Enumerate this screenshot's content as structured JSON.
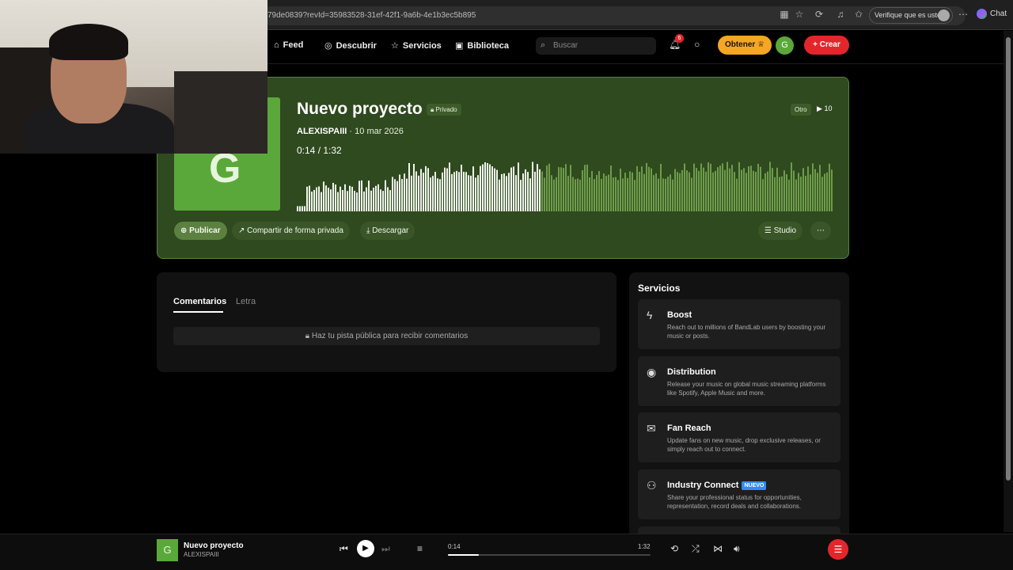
{
  "browser": {
    "url": "79de0839?revId=35983528-31ef-42f1-9a6b-4e1b3ec5b895",
    "verify_label": "Verifique que es usted",
    "chat_label": "Chat"
  },
  "nav": {
    "items": [
      {
        "label": "Feed",
        "icon": "home-icon"
      },
      {
        "label": "Descubrir",
        "icon": "compass-icon"
      },
      {
        "label": "Servicios",
        "icon": "star-icon"
      },
      {
        "label": "Biblioteca",
        "icon": "library-icon"
      }
    ],
    "search_placeholder": "Buscar",
    "notification_count": "6",
    "obtener_label": "Obtener",
    "avatar_letter": "G",
    "crear_label": "Crear"
  },
  "project": {
    "title": "Nuevo proyecto",
    "privacy": "Privado",
    "artist": "ALEXISPAIII",
    "date": "10 mar 2026",
    "current_time": "0:14",
    "duration": "1:32",
    "genre": "Otro",
    "plays": "10",
    "cover_letter": "G",
    "progress": 0.152,
    "accent_color": "#5aa83a",
    "buttons": {
      "publicar": "Publicar",
      "compartir": "Compartir de forma privada",
      "descargar": "Descargar",
      "studio": "Studio"
    }
  },
  "comments": {
    "tabs": [
      "Comentarios",
      "Letra"
    ],
    "notice": "Haz tu pista pública para recibir comentarios"
  },
  "services": {
    "title": "Servicios",
    "cards": [
      {
        "name": "Boost",
        "icon": "lightning-icon",
        "desc": "Reach out to millions of BandLab users by boosting your music or posts."
      },
      {
        "name": "Distribution",
        "icon": "distribution-icon",
        "desc": "Release your music on global music streaming platforms like Spotify, Apple Music and more."
      },
      {
        "name": "Fan Reach",
        "icon": "mail-icon",
        "desc": "Update fans on new music, drop exclusive releases, or simply reach out to connect."
      },
      {
        "name": "Industry Connect",
        "icon": "people-icon",
        "badge": "NUEVO",
        "desc": "Share your professional status for opportunities, representation, record deals and collaborations."
      }
    ]
  },
  "player": {
    "title": "Nuevo proyecto",
    "artist": "ALEXISPAIII",
    "current_time": "0:14",
    "duration": "1:32",
    "progress": 0.152
  }
}
